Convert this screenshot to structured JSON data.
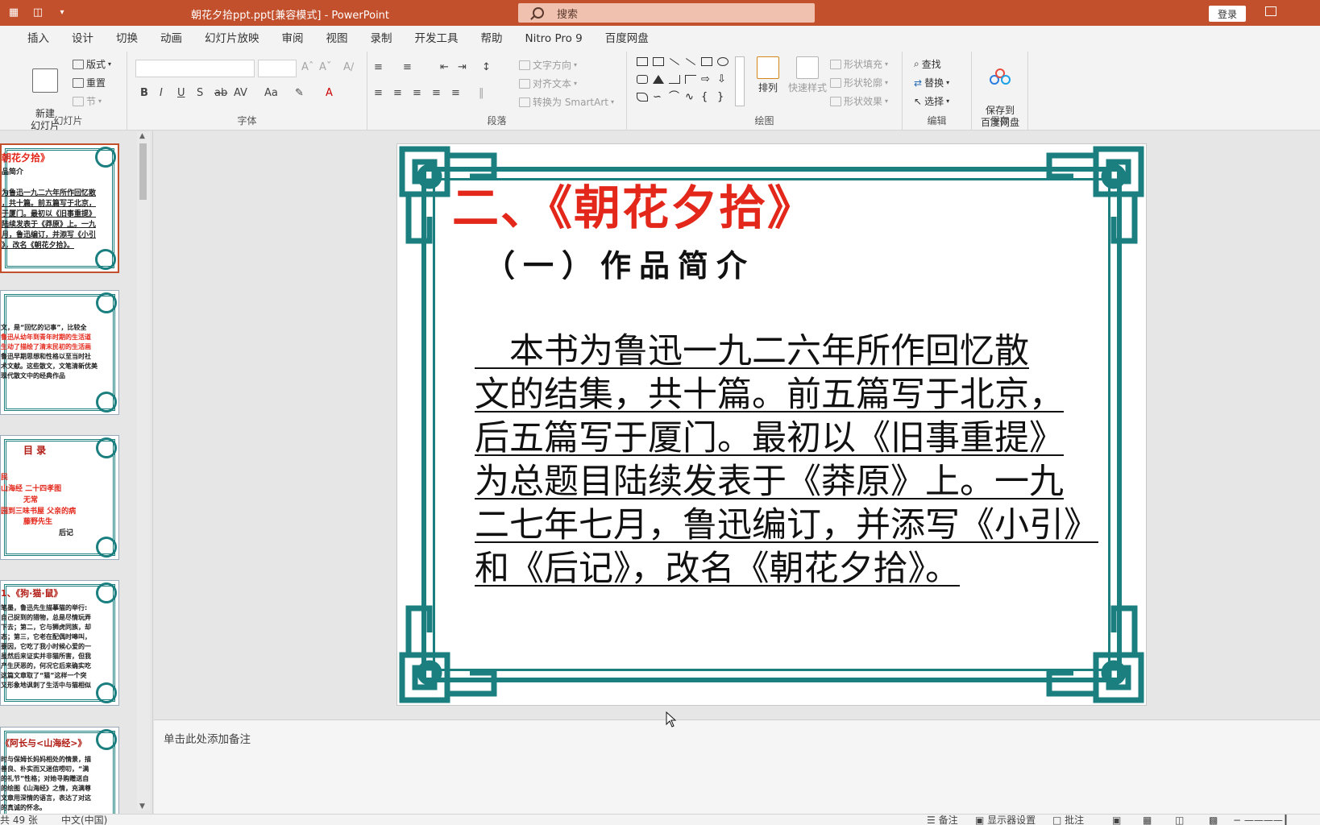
{
  "window": {
    "title": "朝花夕拾ppt.ppt[兼容模式]  -  PowerPoint",
    "search_placeholder": "搜索",
    "login_label": "登录"
  },
  "tabs": [
    "插入",
    "设计",
    "切换",
    "动画",
    "幻灯片放映",
    "审阅",
    "视图",
    "录制",
    "开发工具",
    "帮助",
    "Nitro Pro 9",
    "百度网盘"
  ],
  "ribbon": {
    "slides_group": {
      "label": "幻灯片",
      "new_slide": "新建\n幻灯片",
      "layout": "版式",
      "reset": "重置",
      "section": "节"
    },
    "font_group": {
      "label": "字体"
    },
    "paragraph_group": {
      "label": "段落",
      "text_direction": "文字方向",
      "align_text": "对齐文本",
      "convert_smartart": "转换为 SmartArt"
    },
    "drawing_group": {
      "label": "绘图",
      "arrange": "排列",
      "quick_styles": "快速样式",
      "shape_fill": "形状填充",
      "shape_outline": "形状轮廓",
      "shape_effects": "形状效果"
    },
    "editing_group": {
      "label": "编辑",
      "find": "查找",
      "replace": "替换",
      "select": "选择"
    },
    "save_group": {
      "label": "保存",
      "save_to_baidu": "保存到\n百度网盘"
    }
  },
  "thumbnails": [
    {
      "lines": [
        "朝花夕拾》",
        "品简介",
        "为鲁迅一九二六年所作回忆散",
        "，共十篇。前五篇写于北京，",
        "于厦门。最初以《旧事重提》",
        "陆续发表于《莽原》上。一九",
        "月，鲁迅编订，并添写《小引",
        "》，改名《朝花夕拾》。"
      ]
    },
    {
      "lines": [
        "文，是“回忆的记事”，比较全",
        "鲁迅从幼年到青年时期的生活道",
        "生动了描绘了清末民初的生活画",
        "鲁迅早期思想和性格以至当时社",
        "术文献。这些散文，文笔清新优美",
        "现代散文中的经典作品"
      ]
    },
    {
      "lines": [
        "目 录",
        "民",
        "山海经      二十四孝图",
        "无常",
        "园到三味书屋    父亲的病",
        "藤野先生",
        "后记"
      ]
    },
    {
      "lines": [
        "1、《狗·猫·鼠》",
        "笔墨，鲁迅先生描摹猫的举行:",
        "自己捉到的猎物，总是尽情玩弄",
        "下去；第二，它与狮虎同族，却",
        "态；第三，它老在配偶时嗥叫，",
        "要因，它吃了我小时候心爱的一",
        "虽然后来证实并非猫所害，但我",
        "产生厌恶的，何况它后来确实吃",
        "这篇文章取了“猫”这样一个突",
        "又形象地讽刺了生活中与猫相似"
      ]
    },
    {
      "lines": [
        "《阿长与<山海经>》",
        "时与保姆长妈妈相处的情景，描",
        "善良、朴实而又迷信唠叨，“满",
        "的礼节”性格；对她寻购赠送自",
        "的绘图《山海经》之情，充满尊",
        "文章用深情的语言，表达了对这",
        "的真诚的怀念。"
      ]
    }
  ],
  "slide": {
    "title": "二、《朝花夕拾》",
    "subtitle": "（一）作品简介",
    "body_lines": [
      "　本书为鲁迅一九二六年所作回忆散",
      "文的结集，共十篇。前五篇写于北京，",
      "后五篇写于厦门。最初以《旧事重提》",
      "为总题目陆续发表于《莽原》上。一九",
      "二七年七月，鲁迅编订，并添写《小引》",
      "和《后记》，改名《朝花夕拾》。"
    ]
  },
  "notes": {
    "placeholder": "单击此处添加备注"
  },
  "status": {
    "slide_count": "共 49 张",
    "language": "中文(中国)",
    "notes_btn": "备注",
    "display_settings": "显示器设置",
    "comments": "批注"
  },
  "colors": {
    "accent": "#c3502d",
    "frame_teal": "#1b7f80",
    "title_red": "#e4271b"
  }
}
